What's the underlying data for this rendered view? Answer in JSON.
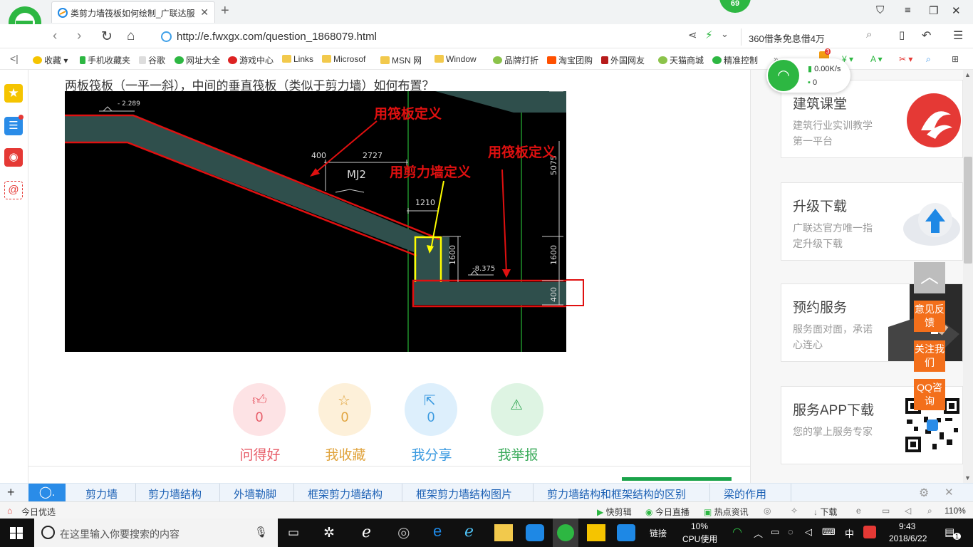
{
  "browser": {
    "tab_title": "类剪力墙筏板如何绘制_广联达服",
    "badge": "69",
    "url": "http://e.fwxgx.com/question_1868079.html",
    "search_text": "360借条免息借4万",
    "network": {
      "speed": "0.00K/s",
      "connections": "0"
    }
  },
  "bookmarks": [
    "收藏",
    "手机收藏夹",
    "谷歌",
    "网址大全",
    "游戏中心",
    "Links",
    "Microsof",
    "MSN 网",
    "Window",
    "品牌打折",
    "淘宝团购",
    "外国网友",
    "天猫商城",
    "精准控制"
  ],
  "extension_badge": "3",
  "question": {
    "title": "两板筏板（一平一斜），中间的垂直筏板（类似于剪力墙）如何布置？"
  },
  "drawing": {
    "annotations": {
      "raft1": "用筏板定义",
      "raft2": "用筏板定义",
      "wall": "用剪力墙定义"
    },
    "dims": {
      "elev_top": "- 2.289",
      "d400": "400",
      "d2727": "2727",
      "mj2": "MJ2",
      "d1210": "1210",
      "d1600v": "1600",
      "elev_bot": "-8.375",
      "d5075": "5075",
      "d1600r": "1600",
      "d400r": "400"
    }
  },
  "actions": [
    {
      "label": "问得好",
      "count": "0",
      "color": "#e75a66",
      "bg": "#fde3e5",
      "icon": "thumbs-up-icon"
    },
    {
      "label": "我收藏",
      "count": "0",
      "color": "#e0a33c",
      "bg": "#fdf0d9",
      "icon": "star-icon"
    },
    {
      "label": "我分享",
      "count": "0",
      "color": "#3a9ae0",
      "bg": "#ddeffc",
      "icon": "share-icon"
    },
    {
      "label": "我举报",
      "count": "0",
      "color": "#3aaa5a",
      "bg": "#def4e3",
      "icon": "warning-icon"
    }
  ],
  "sidebar_cards": [
    {
      "title": "建筑课堂",
      "desc": "建筑行业实训教学第一平台"
    },
    {
      "title": "升级下载",
      "desc": "广联达官方唯一指定升级下载"
    },
    {
      "title": "预约服务",
      "desc": "服务面对面，承诺心连心"
    },
    {
      "title": "服务APP下载",
      "desc": "您的掌上服务专家"
    }
  ],
  "float_buttons": {
    "feedback": "意见反馈",
    "follow": "关注我们",
    "qq": "QQ咨询"
  },
  "tags": [
    "剪力墙",
    "剪力墙结构",
    "外墙勒脚",
    "框架剪力墙结构",
    "框架剪力墙结构图片",
    "剪力墙结构和框架结构的区别",
    "梁的作用"
  ],
  "statusbar": {
    "left": "今日优选",
    "items": [
      "快剪辑",
      "今日直播",
      "热点资讯",
      "下载"
    ],
    "zoom": "110%"
  },
  "taskbar": {
    "search_placeholder": "在这里输入你要搜索的内容",
    "link_label": "链接",
    "cpu_percent": "10%",
    "cpu_label": "CPU使用",
    "ime": "中",
    "time": "9:43",
    "date": "2018/6/22",
    "notifications": "1"
  }
}
